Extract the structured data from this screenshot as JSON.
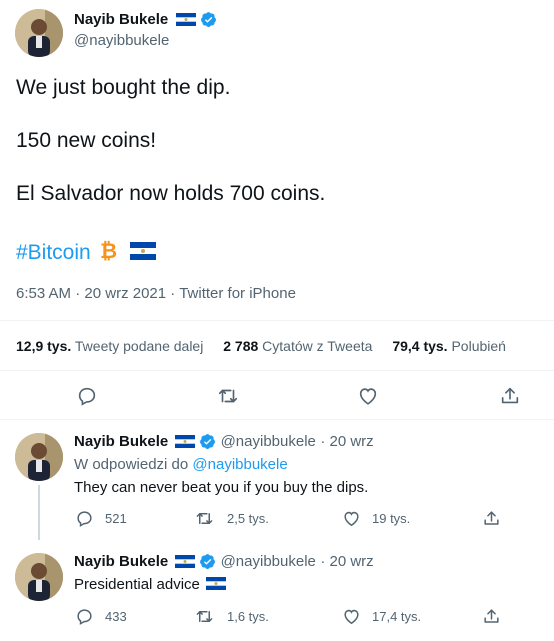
{
  "main_tweet": {
    "author_name": "Nayib Bukele",
    "author_handle": "@nayibbukele",
    "lines": [
      "We just bought the dip.",
      "150 new coins!",
      "El Salvador now holds 700 coins."
    ],
    "hashtag": "#Bitcoin",
    "time": "6:53 AM",
    "date": "20 wrz 2021",
    "source": "Twitter for iPhone",
    "meta_sep": "·",
    "stats": {
      "retweets_value": "12,9 tys.",
      "retweets_label": "Tweety podane dalej",
      "quotes_value": "2 788",
      "quotes_label": "Cytatów z Tweeta",
      "likes_value": "79,4 tys.",
      "likes_label": "Polubień"
    }
  },
  "replies": [
    {
      "author_name": "Nayib Bukele",
      "author_handle": "@nayibbukele",
      "date": "· 20 wrz",
      "reply_prefix": "W odpowiedzi do",
      "reply_to": "@nayibbukele",
      "text": "They can never beat you if you buy the dips.",
      "replies": "521",
      "retweets": "2,5 tys.",
      "likes": "19 tys."
    },
    {
      "author_name": "Nayib Bukele",
      "author_handle": "@nayibbukele",
      "date": "· 20 wrz",
      "text": "Presidential advice",
      "replies": "433",
      "retweets": "1,6 tys.",
      "likes": "17,4 tys."
    }
  ],
  "colors": {
    "accent": "#1d9bf0",
    "bitcoin": "#f7931a",
    "flag_blue": "#0047ab",
    "muted": "#536471"
  },
  "icons": [
    "verified-badge-icon",
    "sv-flag-icon",
    "bitcoin-icon",
    "reply-icon",
    "retweet-icon",
    "like-icon",
    "share-icon"
  ]
}
